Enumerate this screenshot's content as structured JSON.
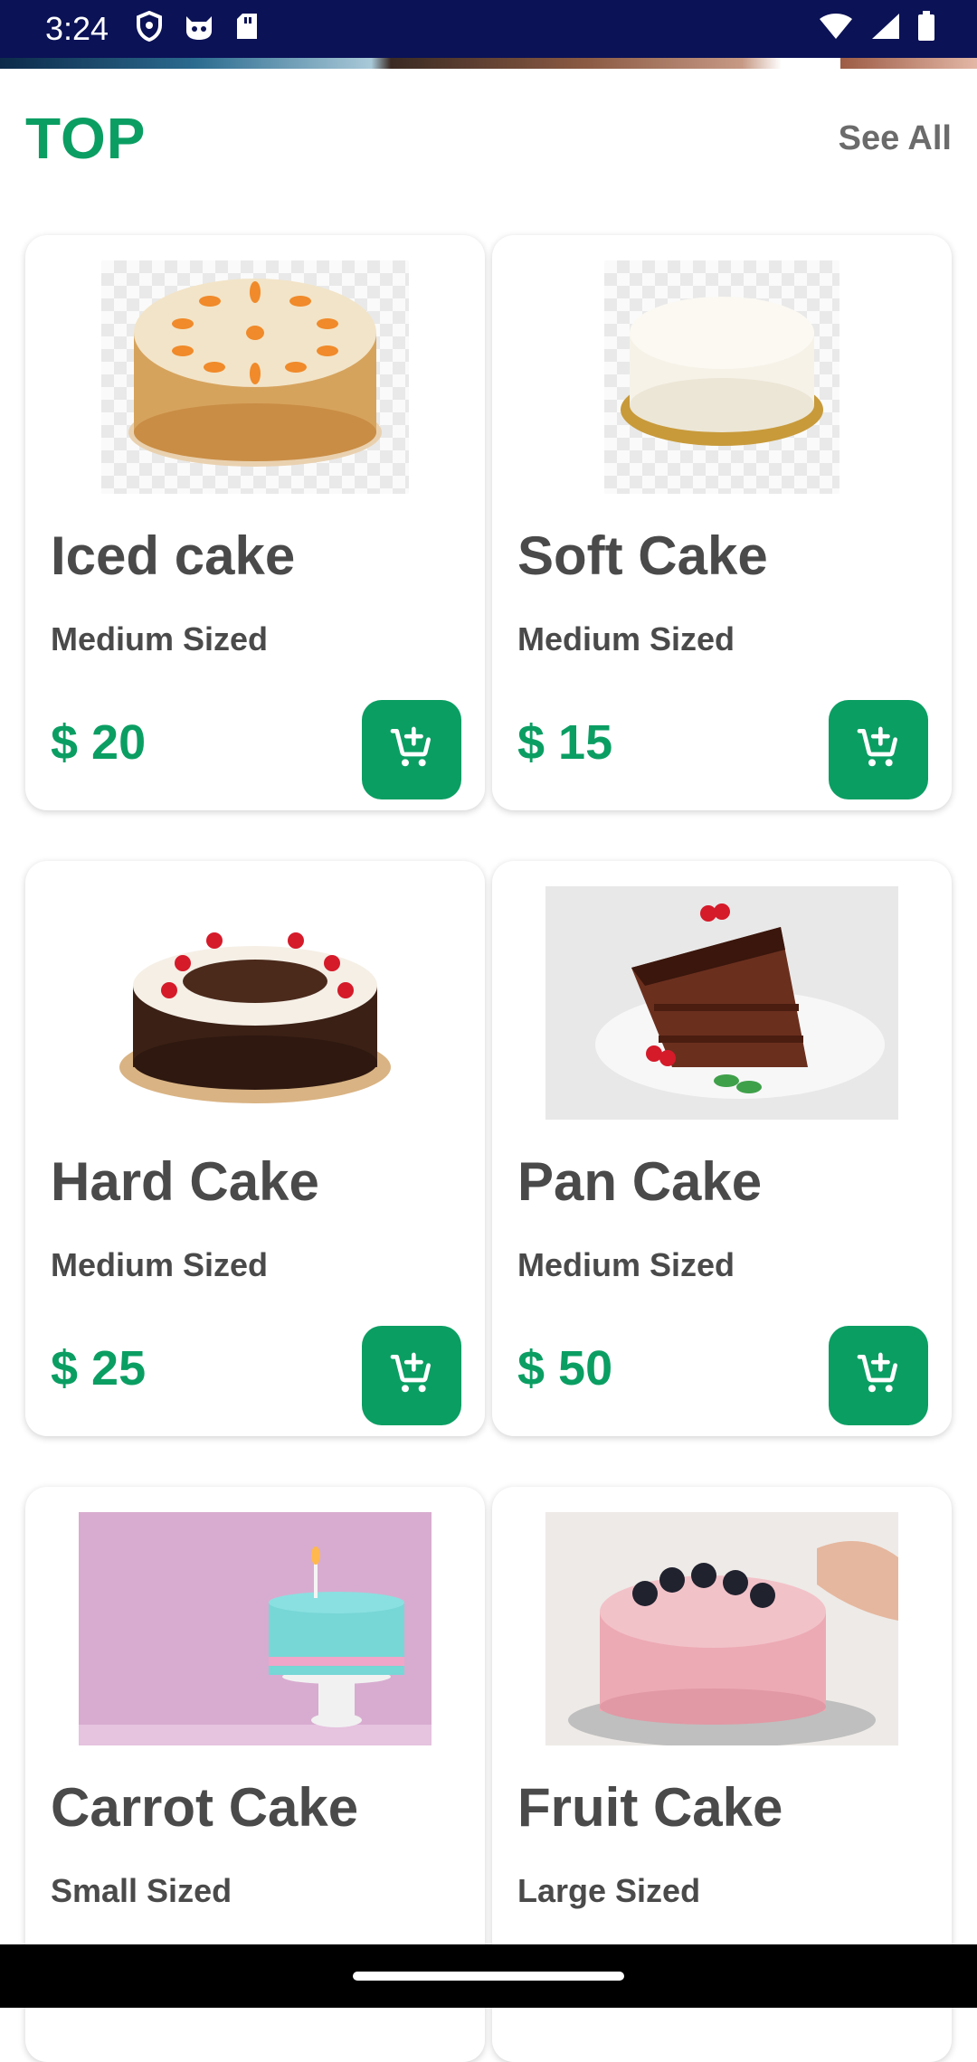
{
  "status_bar": {
    "time": "3:24",
    "left_icons": [
      "shield-icon",
      "cat-icon",
      "sd-card-icon"
    ],
    "right_icons": [
      "wifi-icon",
      "signal-icon",
      "battery-icon"
    ]
  },
  "section": {
    "title": "TOP",
    "see_all_label": "See All"
  },
  "colors": {
    "accent": "#0b9e63",
    "status_bar_bg": "#0b1256",
    "text_dark": "#4a4a4a"
  },
  "products": [
    {
      "name": "Iced cake",
      "size": "Medium Sized",
      "price": "$ 20",
      "image": "carrot-cake-image",
      "cart_icon": "add-to-cart-icon"
    },
    {
      "name": "Soft Cake",
      "size": "Medium Sized",
      "price": "$ 15",
      "image": "white-cake-image",
      "cart_icon": "add-to-cart-icon"
    },
    {
      "name": "Hard Cake",
      "size": "Medium Sized",
      "price": "$ 25",
      "image": "black-forest-cake-image",
      "cart_icon": "add-to-cart-icon"
    },
    {
      "name": "Pan Cake",
      "size": "Medium Sized",
      "price": "$ 50",
      "image": "chocolate-slice-image",
      "cart_icon": "add-to-cart-icon"
    },
    {
      "name": "Carrot Cake",
      "size": "Small Sized",
      "price": "",
      "image": "birthday-cake-image",
      "cart_icon": "add-to-cart-icon"
    },
    {
      "name": "Fruit Cake",
      "size": "Large Sized",
      "price": "",
      "image": "pink-cake-image",
      "cart_icon": "add-to-cart-icon"
    }
  ]
}
